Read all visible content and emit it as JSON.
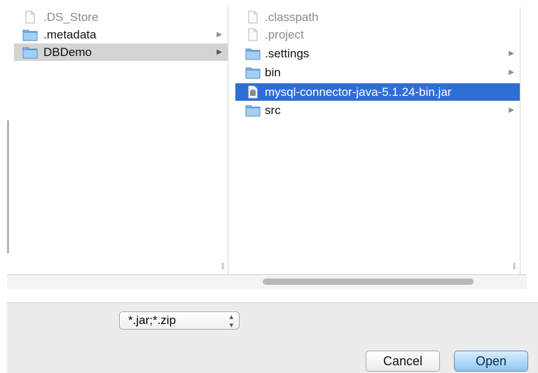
{
  "column_left": {
    "items": [
      {
        "label": ".DS_Store",
        "type": "file",
        "dim": true
      },
      {
        "label": ".metadata",
        "type": "folder",
        "arrow": "▶"
      },
      {
        "label": "DBDemo",
        "type": "folder",
        "arrow": "▶",
        "active": true
      }
    ]
  },
  "column_right": {
    "items": [
      {
        "label": ".classpath",
        "type": "file",
        "dim": true
      },
      {
        "label": ".project",
        "type": "file",
        "dim": true
      },
      {
        "label": ".settings",
        "type": "folder",
        "arrow": "▶"
      },
      {
        "label": "bin",
        "type": "folder",
        "arrow": "▶"
      },
      {
        "label": "mysql-connector-java-5.1.24-bin.jar",
        "type": "jar",
        "selected": true
      },
      {
        "label": "src",
        "type": "folder",
        "arrow": "▶"
      }
    ]
  },
  "resize_glyph": "||",
  "filter": {
    "value": "*.jar;*.zip",
    "stepper": "▲\n▼"
  },
  "buttons": {
    "cancel": "Cancel",
    "open": "Open"
  },
  "colors": {
    "selection": "#2f6ed4",
    "active_row": "#d4d4d4",
    "folder": "#7fb7e8"
  }
}
